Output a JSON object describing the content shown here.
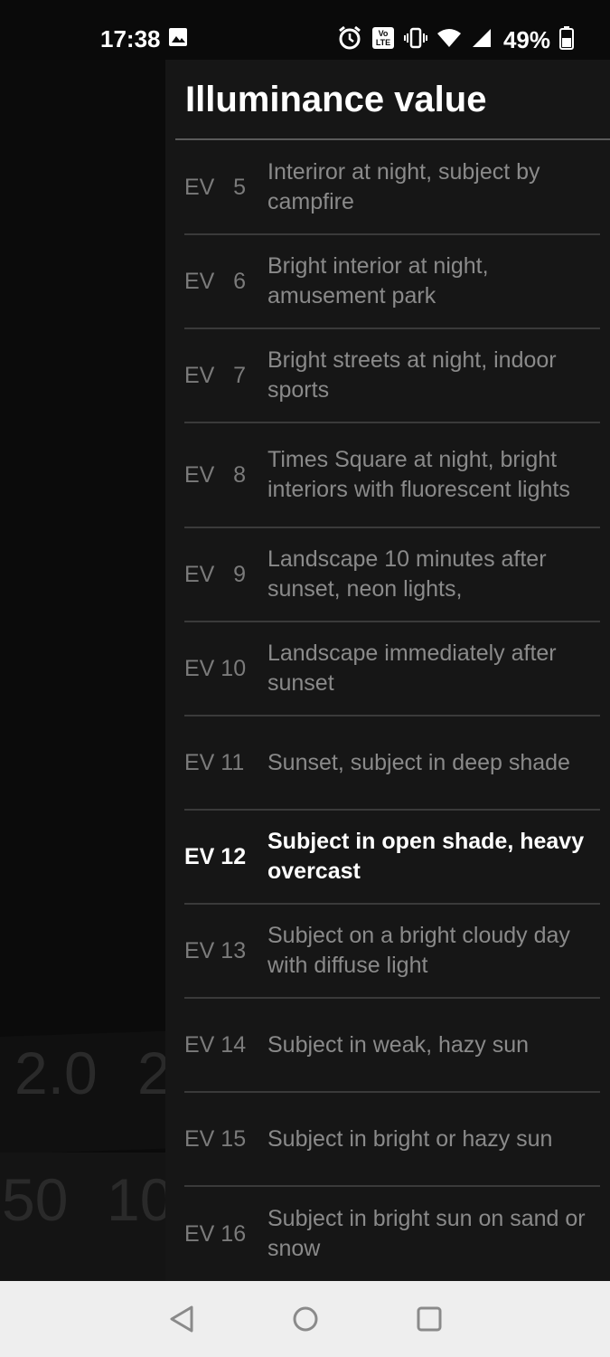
{
  "status_bar": {
    "time": "17:38",
    "battery": "49%",
    "icons": [
      "image-icon",
      "alarm-icon",
      "volte-icon",
      "vibrate-icon",
      "wifi-icon",
      "signal-icon",
      "battery-icon"
    ]
  },
  "background": {
    "aperture_values": [
      "2.0",
      "2"
    ],
    "shutter_values": [
      "50",
      "10"
    ]
  },
  "drawer": {
    "title": "Illuminance value",
    "items": [
      {
        "ev": "EV   5",
        "desc": "Interiror at night, subject by campfire"
      },
      {
        "ev": "EV   6",
        "desc": "Bright interior at night, amusement park"
      },
      {
        "ev": "EV   7",
        "desc": "Bright streets at night, indoor sports"
      },
      {
        "ev": "EV   8",
        "desc": "Times Square at night, bright interiors with fluorescent lights"
      },
      {
        "ev": "EV   9",
        "desc": "Landscape 10 minutes after sunset, neon lights,"
      },
      {
        "ev": "EV 10",
        "desc": "Landscape immediately after sunset"
      },
      {
        "ev": "EV 11",
        "desc": "Sunset, subject in deep shade"
      },
      {
        "ev": "EV 12",
        "desc": "Subject in open shade, heavy overcast"
      },
      {
        "ev": "EV 13",
        "desc": "Subject on a bright cloudy day with diffuse light"
      },
      {
        "ev": "EV 14",
        "desc": "Subject in weak, hazy sun"
      },
      {
        "ev": "EV 15",
        "desc": "Subject in bright or hazy sun"
      },
      {
        "ev": "EV 16",
        "desc": "Subject in bright sun on sand or snow"
      }
    ],
    "selected_ev": "EV 12"
  },
  "nav_bar": {
    "buttons": [
      "back-icon",
      "home-icon",
      "recents-icon"
    ]
  },
  "colors": {
    "drawer_bg": "#161616",
    "text_dim": "#8a8a8a",
    "text_selected": "#ffffff",
    "divider": "#3a3a3a"
  }
}
